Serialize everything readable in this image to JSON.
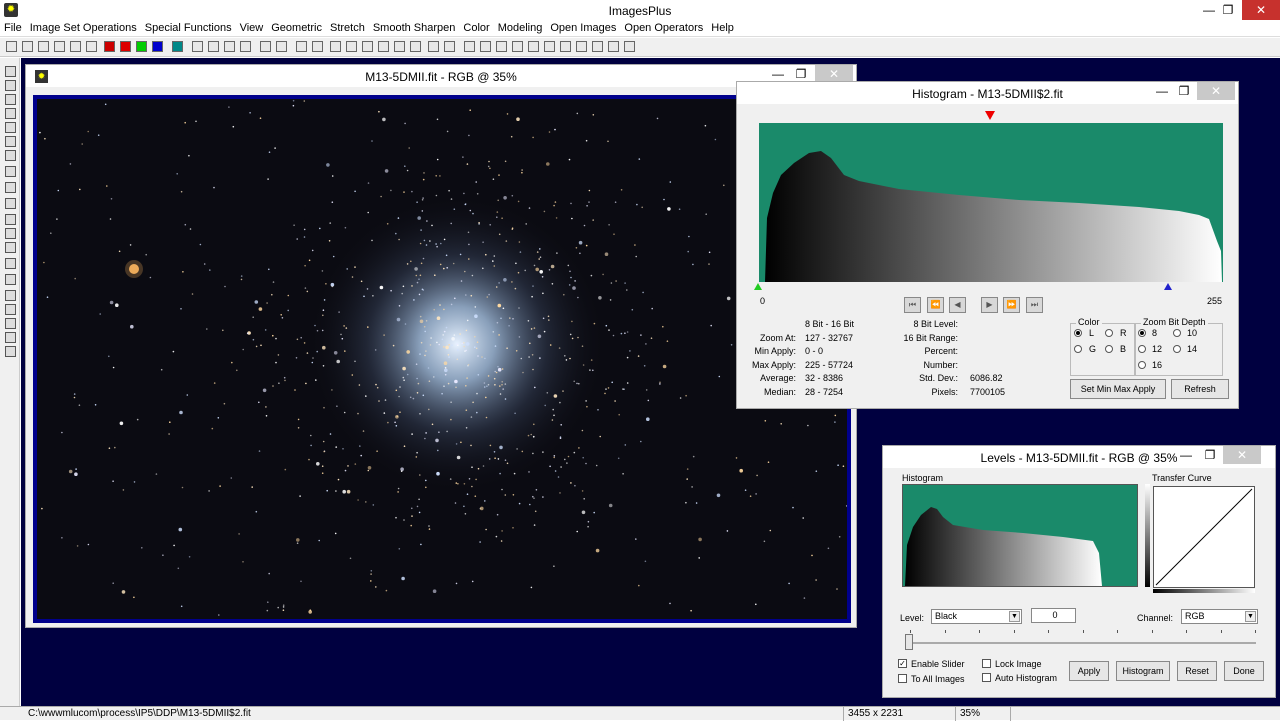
{
  "app": {
    "title": "ImagesPlus"
  },
  "menu": [
    "File",
    "Image Set Operations",
    "Special Functions",
    "View",
    "Geometric",
    "Stretch",
    "Smooth Sharpen",
    "Color",
    "Modeling",
    "Open Images",
    "Open Operators",
    "Help"
  ],
  "image_window": {
    "title": "M13-5DMII.fit - RGB @ 35%"
  },
  "histogram": {
    "title": "Histogram - M13-5DMII$2.fit",
    "axis_min": "0",
    "axis_max": "255",
    "stats_left": [
      [
        "",
        "8 Bit - 16 Bit"
      ],
      [
        "Zoom At:",
        "127 - 32767"
      ],
      [
        "Min Apply:",
        "0 - 0"
      ],
      [
        "Max Apply:",
        "225 - 57724"
      ],
      [
        "Average:",
        "32 - 8386"
      ],
      [
        "Median:",
        "28 - 7254"
      ]
    ],
    "stats_right": [
      [
        "8 Bit Level:",
        ""
      ],
      [
        "16 Bit Range:",
        ""
      ],
      [
        "Percent:",
        ""
      ],
      [
        "Number:",
        ""
      ],
      [
        "Std. Dev.:",
        "6086.82"
      ],
      [
        "Pixels:",
        "7700105"
      ]
    ],
    "color_group": "Color",
    "color_opts": [
      "L",
      "R",
      "G",
      "B"
    ],
    "zoom_group": "Zoom Bit Depth",
    "zoom_opts": [
      "8",
      "10",
      "12",
      "14",
      "16"
    ],
    "btn_set": "Set Min Max Apply",
    "btn_refresh": "Refresh"
  },
  "levels": {
    "title": "Levels - M13-5DMII.fit - RGB @ 35%",
    "hist_label": "Histogram",
    "curve_label": "Transfer Curve",
    "level_label": "Level:",
    "level_value": "Black",
    "level_num": "0",
    "channel_label": "Channel:",
    "channel_value": "RGB",
    "enable_slider": "Enable Slider",
    "to_all": "To All Images",
    "lock_image": "Lock Image",
    "auto_hist": "Auto Histogram",
    "btn_apply": "Apply",
    "btn_hist": "Histogram",
    "btn_reset": "Reset",
    "btn_done": "Done"
  },
  "status": {
    "path": "C:\\wwwmlucom\\process\\IP5\\DDP\\M13-5DMII$2.fit",
    "dims": "3455 x 2231",
    "zoom": "35%"
  }
}
